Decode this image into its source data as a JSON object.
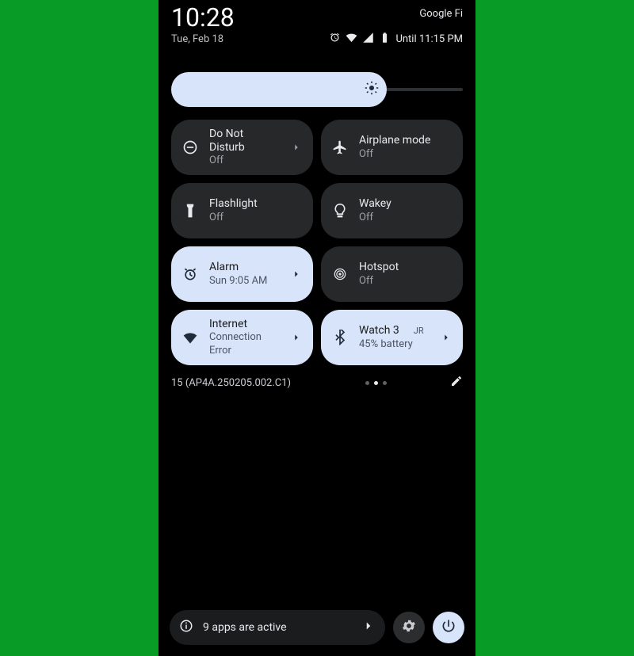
{
  "status": {
    "time": "10:28",
    "carrier": "Google Fi",
    "date": "Tue, Feb 18",
    "battery_until": "Until 11:15 PM"
  },
  "brightness": {
    "percent": 74
  },
  "tiles": [
    {
      "id": "dnd",
      "label": "Do Not Disturb",
      "sub": "Off",
      "active": false,
      "chevron": true
    },
    {
      "id": "airplane",
      "label": "Airplane mode",
      "sub": "Off",
      "active": false,
      "chevron": false
    },
    {
      "id": "flashlight",
      "label": "Flashlight",
      "sub": "Off",
      "active": false,
      "chevron": false
    },
    {
      "id": "wakey",
      "label": "Wakey",
      "sub": "Off",
      "active": false,
      "chevron": false
    },
    {
      "id": "alarm",
      "label": "Alarm",
      "sub": "Sun 9:05 AM",
      "active": true,
      "chevron": true
    },
    {
      "id": "hotspot",
      "label": "Hotspot",
      "sub": "Off",
      "active": false,
      "chevron": false
    },
    {
      "id": "internet",
      "label": "Internet",
      "sub": "Connection Error",
      "active": true,
      "chevron": true
    },
    {
      "id": "bluetooth",
      "label": "Watch 3",
      "sub": "45% battery",
      "active": true,
      "chevron": true,
      "badge": "JR"
    }
  ],
  "build": "15 (AP4A.250205.002.C1)",
  "page_indicator": {
    "total": 3,
    "current": 1
  },
  "footer": {
    "apps_label": "9 apps are active"
  }
}
